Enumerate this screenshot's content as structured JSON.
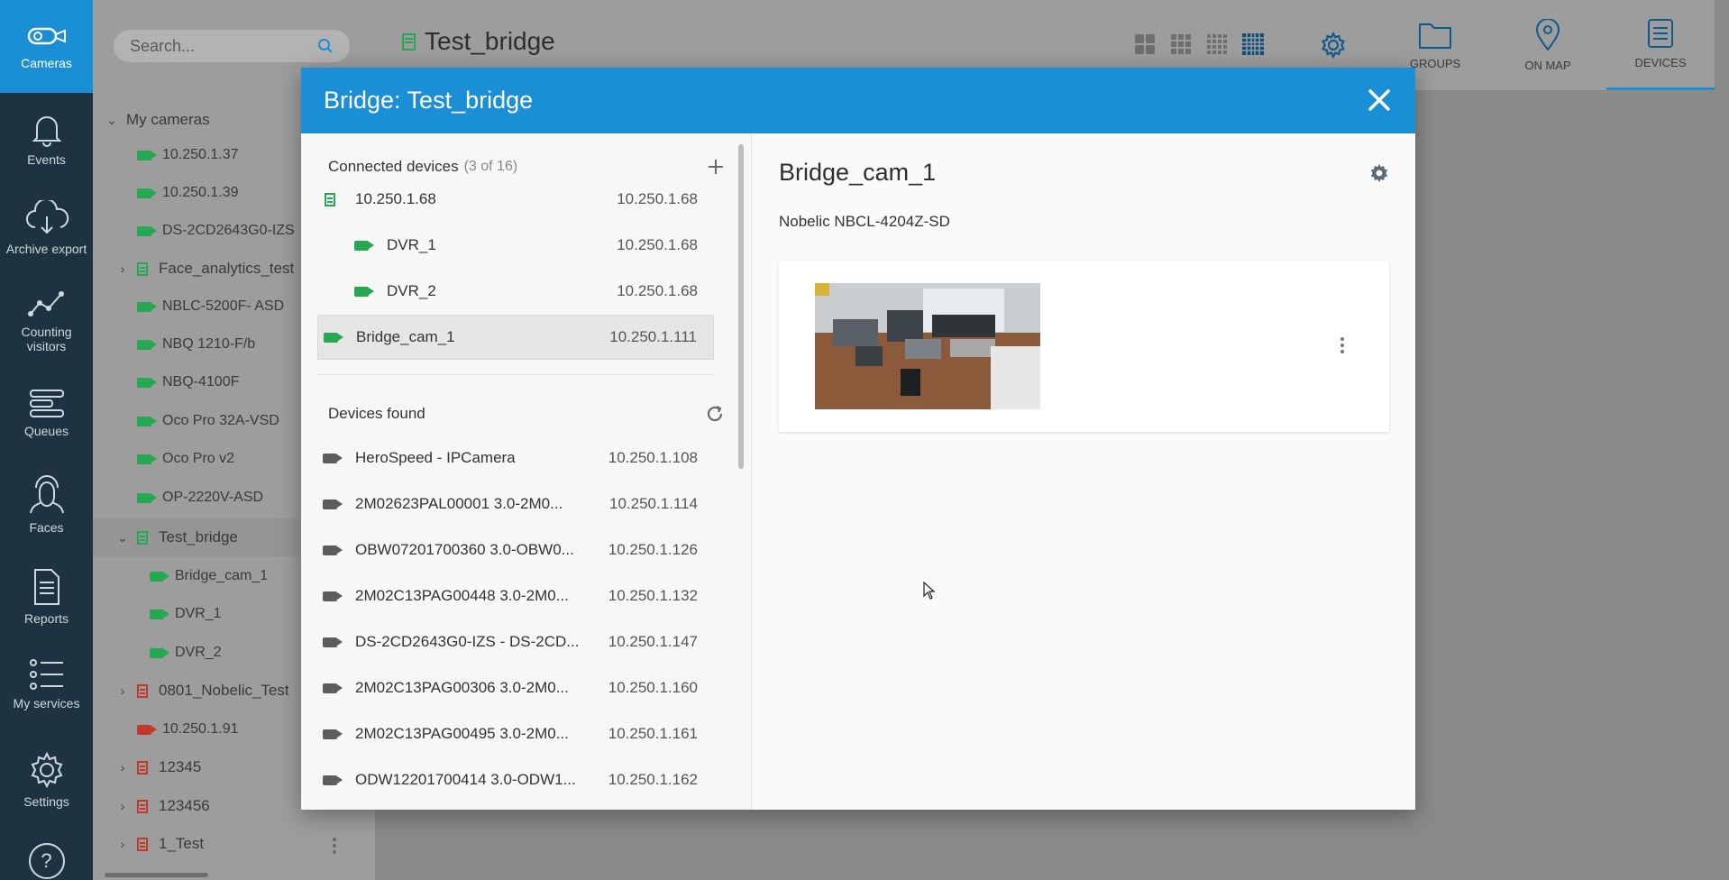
{
  "rail": {
    "cameras": "Cameras",
    "events": "Events",
    "archive_export": "Archive export",
    "counting_line1": "Counting",
    "counting_line2": "visitors",
    "queues": "Queues",
    "faces": "Faces",
    "reports": "Reports",
    "my_services": "My services",
    "settings": "Settings",
    "help": "?"
  },
  "search": {
    "placeholder": "Search..."
  },
  "tree": {
    "my_cameras": "My cameras",
    "items": [
      "10.250.1.37",
      "10.250.1.39",
      "DS-2CD2643G0-IZS",
      "Face_analytics_test",
      "NBLC-5200F- ASD",
      "NBQ 1210-F/b",
      "NBQ-4100F",
      "Oco Pro 32A-VSD",
      "Oco Pro v2",
      "OP-2220V-ASD",
      "Test_bridge",
      "Bridge_cam_1",
      "DVR_1",
      "DVR_2",
      "0801_Nobelic_Test",
      "10.250.1.91",
      "12345",
      "123456",
      "1_Test"
    ]
  },
  "topbar": {
    "title": "Test_bridge",
    "groups": "GROUPS",
    "on_map": "ON MAP",
    "devices": "DEVICES"
  },
  "modal": {
    "title": "Bridge: Test_bridge",
    "connected": {
      "heading": "Connected devices",
      "count": "(3 of 16)",
      "rows": [
        {
          "name": "10.250.1.68",
          "ip": "10.250.1.68"
        },
        {
          "name": "DVR_1",
          "ip": "10.250.1.68"
        },
        {
          "name": "DVR_2",
          "ip": "10.250.1.68"
        },
        {
          "name": "Bridge_cam_1",
          "ip": "10.250.1.111"
        }
      ]
    },
    "found": {
      "heading": "Devices found",
      "rows": [
        {
          "name": "HeroSpeed - IPCamera",
          "ip": "10.250.1.108"
        },
        {
          "name": "2M02623PAL00001 3.0-2M0...",
          "ip": "10.250.1.114"
        },
        {
          "name": "OBW07201700360 3.0-OBW0...",
          "ip": "10.250.1.126"
        },
        {
          "name": "2M02C13PAG00448 3.0-2M0...",
          "ip": "10.250.1.132"
        },
        {
          "name": "DS-2CD2643G0-IZS - DS-2CD...",
          "ip": "10.250.1.147"
        },
        {
          "name": "2M02C13PAG00306 3.0-2M0...",
          "ip": "10.250.1.160"
        },
        {
          "name": "2M02C13PAG00495 3.0-2M0...",
          "ip": "10.250.1.161"
        },
        {
          "name": "ODW12201700414 3.0-ODW1...",
          "ip": "10.250.1.162"
        }
      ]
    },
    "detail": {
      "name": "Bridge_cam_1",
      "model": "Nobelic NBCL-4204Z-SD"
    }
  },
  "colors": {
    "accent": "#1a8fd6",
    "rail": "#1e3342",
    "online": "#26a852",
    "offline": "#c0392b"
  }
}
